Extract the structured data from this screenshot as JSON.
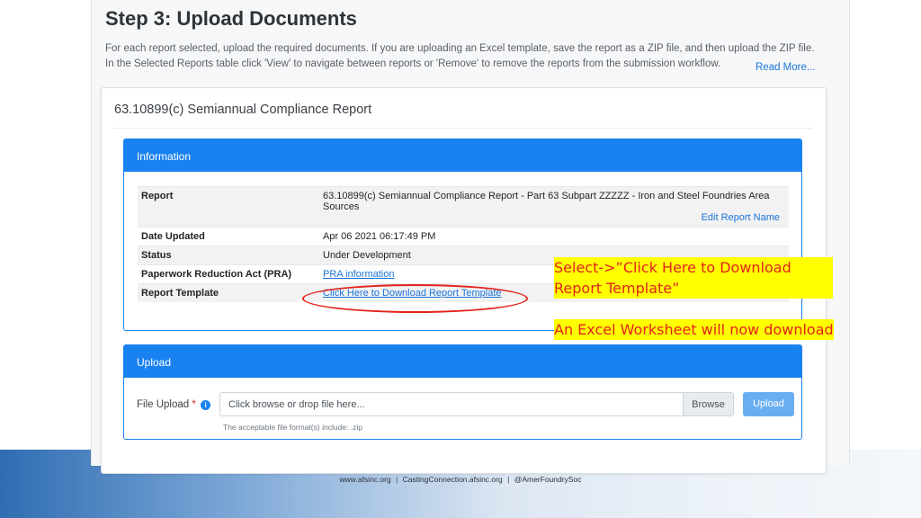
{
  "step": {
    "title": "Step 3: Upload Documents",
    "description": "For each report selected, upload the required documents. If you are uploading an Excel template, save the report as a ZIP file, and then upload the ZIP file. In the Selected Reports table click 'View' to navigate between reports or 'Remove' to remove the reports from the submission workflow.",
    "read_more": "Read More..."
  },
  "card": {
    "title": "63.10899(c) Semiannual Compliance Report"
  },
  "information": {
    "header": "Information",
    "rows": [
      {
        "label": "Report",
        "value": "63.10899(c) Semiannual Compliance Report - Part 63 Subpart ZZZZZ - Iron and Steel Foundries Area Sources",
        "action": "Edit Report Name"
      },
      {
        "label": "Date Updated",
        "value": "Apr 06 2021 06:17:49 PM"
      },
      {
        "label": "Status",
        "value": "Under Development"
      },
      {
        "label": "Paperwork Reduction Act (PRA)",
        "link": "PRA information"
      },
      {
        "label": "Report Template",
        "link": "Click Here to Download Report Template"
      }
    ]
  },
  "upload": {
    "header": "Upload",
    "label": "File Upload",
    "required_mark": "*",
    "info_icon": "i",
    "placeholder": "Click browse or drop file here...",
    "browse": "Browse",
    "upload_button": "Upload",
    "hint": "The acceptable file format(s) include: .zip"
  },
  "annotations": {
    "select": "Select->”Click Here to Download Report Template”",
    "excel": "An Excel Worksheet will now download"
  },
  "footer": {
    "site": "www.afsinc.org",
    "casting": "CastingConnection.afsinc.org",
    "social": "@AmerFoundrySoc"
  },
  "colors": {
    "primary": "#1a82f0",
    "annotation_text": "#e2231a",
    "annotation_bg": "#ffff00"
  }
}
